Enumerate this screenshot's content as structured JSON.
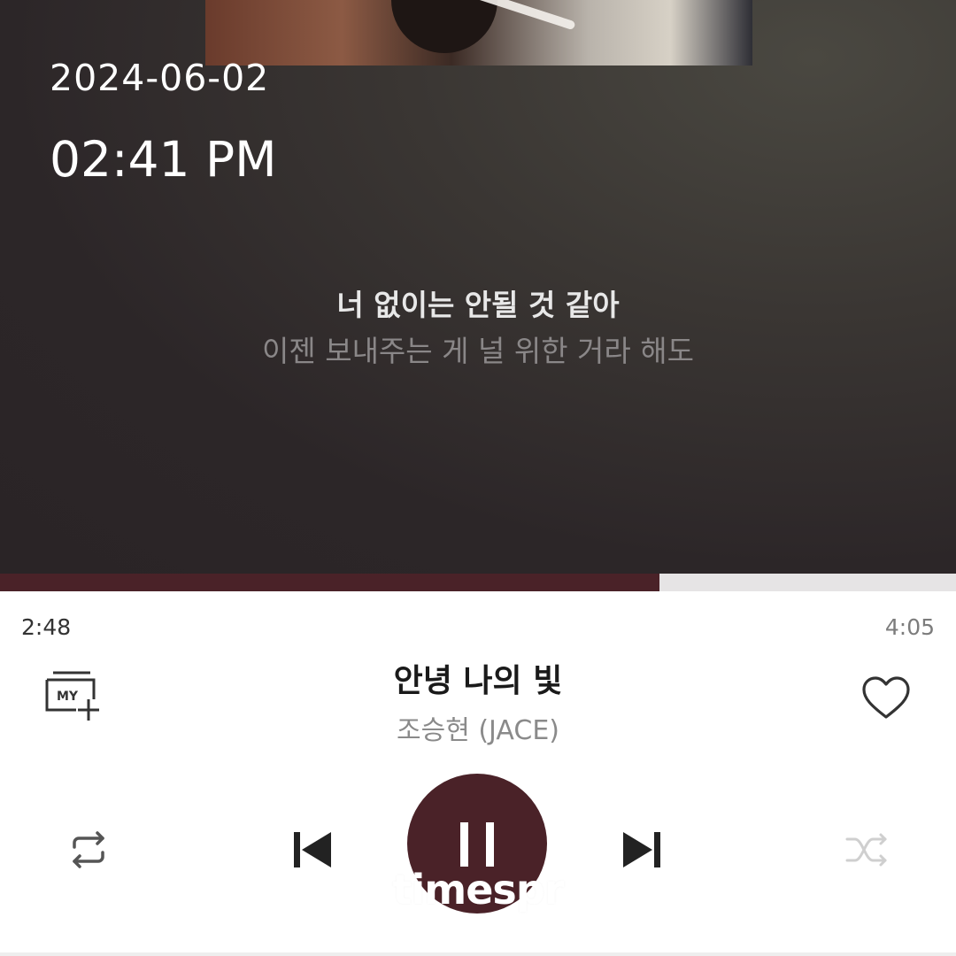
{
  "status": {
    "date": "2024-06-02",
    "time": "02:41 PM"
  },
  "lyrics": {
    "current": "너 없이는 안될 것 같아",
    "next": "이젠 보내주는 게 널 위한 거라 해도"
  },
  "progress": {
    "elapsed": "2:48",
    "total": "4:05",
    "fraction": 0.69
  },
  "song": {
    "title": "안녕 나의 빛",
    "artist": "조승현 (JACE)"
  },
  "buttons": {
    "my_add_label": "MY",
    "my_add_icon": "playlist-add-icon",
    "favorite_icon": "heart-outline-icon",
    "repeat_icon": "repeat-icon",
    "previous_icon": "skip-previous-icon",
    "play_pause_icon": "pause-icon",
    "next_icon": "skip-next-icon",
    "shuffle_icon": "shuffle-icon"
  },
  "watermark": "timespr",
  "colors": {
    "accent": "#4a2228",
    "progress_track": "#e6e4e5"
  }
}
